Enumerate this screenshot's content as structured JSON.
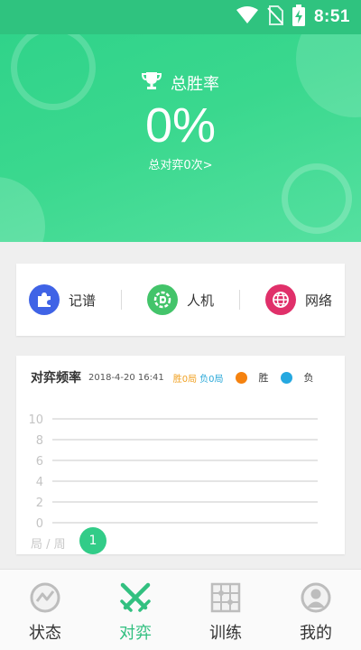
{
  "status_bar": {
    "time": "8:51",
    "icons": [
      "wifi-icon",
      "no-sim-icon",
      "battery-charging-icon"
    ]
  },
  "header": {
    "winrate_label": "总胜率",
    "winrate_value": "0%",
    "total_games_link": "总对弈0次>",
    "icon": "trophy-icon"
  },
  "modes": [
    {
      "label": "记谱",
      "icon": "puzzle-icon",
      "color": "#3f63e6"
    },
    {
      "label": "人机",
      "icon": "robot-icon",
      "color": "#43c46a"
    },
    {
      "label": "网络",
      "icon": "globe-icon",
      "color": "#e0306a"
    }
  ],
  "frequency": {
    "title": "对弈频率",
    "date": "2018-4-20 16:41",
    "win_count": "胜0局",
    "loss_count": "负0局",
    "legend_win": "胜",
    "legend_loss": "负",
    "win_color": "#f5820f",
    "loss_color": "#25a8e0",
    "x_axis_label": "局 / 周",
    "week_badge": "1"
  },
  "chart_data": {
    "type": "line",
    "title": "对弈频率",
    "xlabel": "局 / 周",
    "ylabel": "",
    "ylim": [
      0,
      10
    ],
    "y_ticks": [
      "0",
      "2",
      "4",
      "6",
      "8",
      "10"
    ],
    "categories": [
      "1"
    ],
    "series": [
      {
        "name": "胜",
        "values": [
          0
        ]
      },
      {
        "name": "负",
        "values": [
          0
        ]
      }
    ],
    "grid": true
  },
  "bottom_nav": [
    {
      "label": "状态",
      "icon": "status-icon",
      "active": false
    },
    {
      "label": "对弈",
      "icon": "crossed-swords-icon",
      "active": true
    },
    {
      "label": "训练",
      "icon": "board-grid-icon",
      "active": false
    },
    {
      "label": "我的",
      "icon": "user-avatar-icon",
      "active": false
    }
  ]
}
